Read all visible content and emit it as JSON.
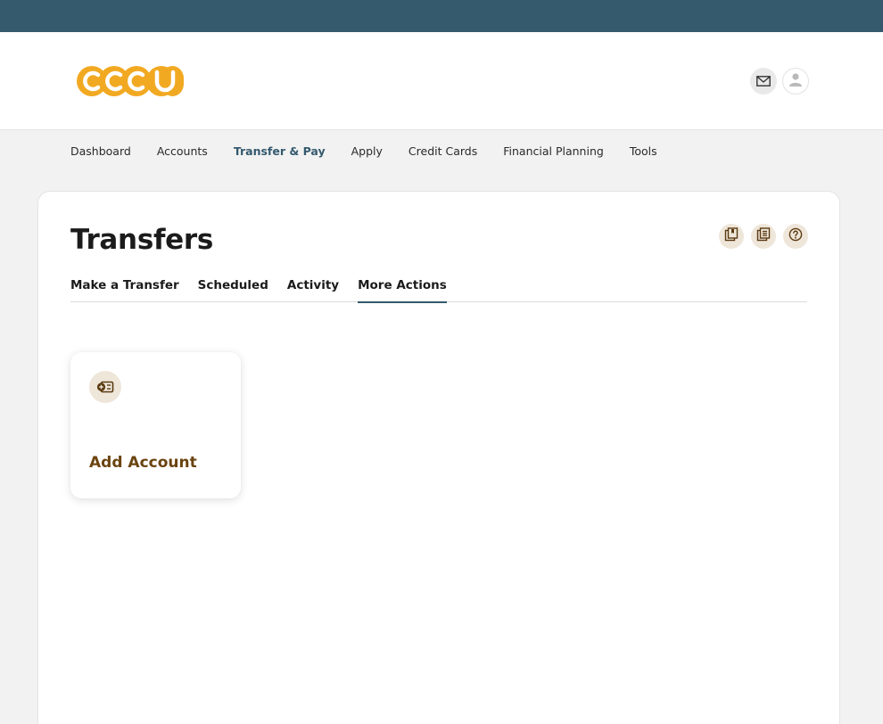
{
  "brand": {
    "logo_text": "CCCU",
    "logo_color": "#f2a922",
    "top_strip_color": "#355a6e"
  },
  "header": {
    "icons": [
      "mail-icon",
      "user-icon"
    ]
  },
  "nav": {
    "items": [
      {
        "label": "Dashboard",
        "active": false
      },
      {
        "label": "Accounts",
        "active": false
      },
      {
        "label": "Transfer & Pay",
        "active": true
      },
      {
        "label": "Apply",
        "active": false
      },
      {
        "label": "Credit Cards",
        "active": false
      },
      {
        "label": "Financial Planning",
        "active": false
      },
      {
        "label": "Tools",
        "active": false
      }
    ]
  },
  "main": {
    "title": "Transfers",
    "title_icons": [
      "bookmark-add-icon",
      "document-list-icon",
      "help-icon"
    ],
    "tabs": [
      {
        "label": "Make a Transfer",
        "active": false
      },
      {
        "label": "Scheduled",
        "active": false
      },
      {
        "label": "Activity",
        "active": false
      },
      {
        "label": "More Actions",
        "active": true
      }
    ],
    "actions": [
      {
        "label": "Add Account",
        "icon": "add-account-icon"
      }
    ]
  },
  "colors": {
    "accent": "#355a6e",
    "action_text": "#6b4410",
    "icon_bg": "#efe6da"
  }
}
